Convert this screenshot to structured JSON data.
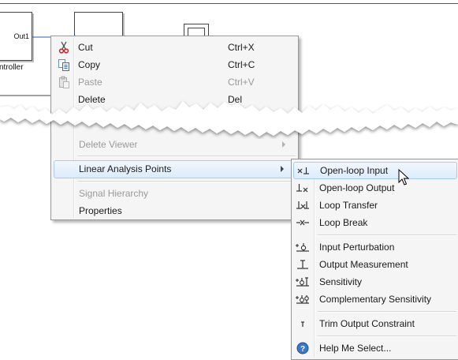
{
  "canvas": {
    "controller_port": "Out1",
    "controller_label": "ntroller"
  },
  "context_menu": {
    "items": [
      {
        "label": "Cut",
        "shortcut": "Ctrl+X",
        "icon": "scissors-icon",
        "enabled": true
      },
      {
        "label": "Copy",
        "shortcut": "Ctrl+C",
        "icon": "copy-icon",
        "enabled": true
      },
      {
        "label": "Paste",
        "shortcut": "Ctrl+V",
        "icon": "paste-icon",
        "enabled": false
      },
      {
        "label": "Delete",
        "shortcut": "Del",
        "enabled": true
      }
    ],
    "lower_items": [
      {
        "label": "Delete Viewer",
        "enabled": false,
        "has_submenu": true
      },
      {
        "label": "Linear Analysis Points",
        "enabled": true,
        "has_submenu": true,
        "selected": true
      },
      {
        "label": "Signal Hierarchy",
        "enabled": false
      },
      {
        "label": "Properties",
        "enabled": true
      }
    ]
  },
  "submenu": {
    "groups": [
      [
        {
          "label": "Open-loop Input",
          "icon": "open-loop-input-icon",
          "hovered": true
        },
        {
          "label": "Open-loop Output",
          "icon": "open-loop-output-icon"
        },
        {
          "label": "Loop Transfer",
          "icon": "loop-transfer-icon"
        },
        {
          "label": "Loop Break",
          "icon": "loop-break-icon"
        }
      ],
      [
        {
          "label": "Input Perturbation",
          "icon": "input-perturbation-icon"
        },
        {
          "label": "Output Measurement",
          "icon": "output-measurement-icon"
        },
        {
          "label": "Sensitivity",
          "icon": "sensitivity-icon"
        },
        {
          "label": "Complementary Sensitivity",
          "icon": "complementary-sensitivity-icon"
        }
      ],
      [
        {
          "label": "Trim Output Constraint",
          "icon": "trim-output-constraint-icon"
        }
      ],
      [
        {
          "label": "Help Me Select...",
          "icon": "help-icon"
        }
      ]
    ]
  },
  "colors": {
    "menu_bg": "#f5f5f5",
    "highlight_border": "#a9ccee",
    "disabled_text": "#9a9a9a",
    "help_icon_blue": "#3b78c6"
  }
}
